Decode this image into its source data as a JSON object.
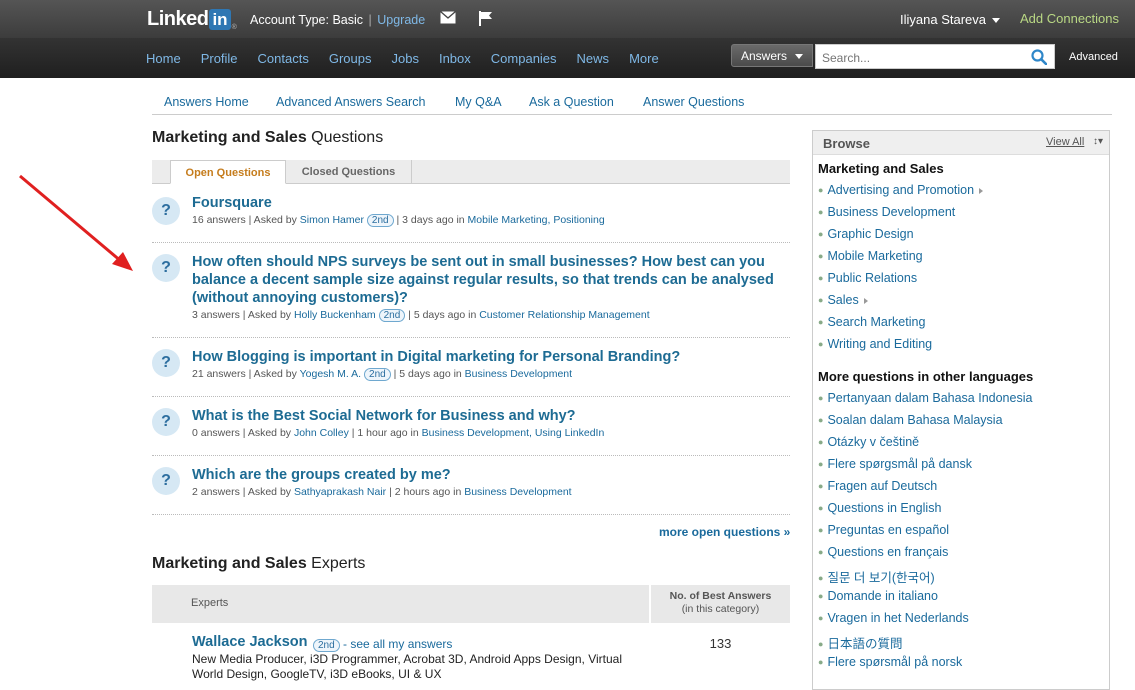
{
  "topbar": {
    "logo_text": "Linked",
    "logo_in": "in",
    "logo_reg": "®",
    "account_type": "Account Type: Basic",
    "separator": "|",
    "upgrade": "Upgrade",
    "user_name": "Iliyana Stareva",
    "add_connections": "Add Connections"
  },
  "nav": {
    "items": [
      "Home",
      "Profile",
      "Contacts",
      "Groups",
      "Jobs",
      "Inbox",
      "Companies",
      "News",
      "More"
    ],
    "search_type": "Answers",
    "search_placeholder": "Search...",
    "advanced": "Advanced"
  },
  "subnav": {
    "items": [
      "Answers Home",
      "Advanced Answers Search",
      "My Q&A",
      "Ask a Question",
      "Answer Questions"
    ]
  },
  "questions_section": {
    "title_bold": "Marketing and Sales",
    "title_rest": " Questions",
    "tabs": [
      "Open Questions",
      "Closed Questions"
    ],
    "icon_char": "?",
    "items": [
      {
        "title": "Foursquare",
        "answers": "16 answers",
        "asked_by": " | Asked by ",
        "author": "Simon Hamer",
        "degree": "2nd",
        "when": " | 3 days ago in ",
        "categories": "Mobile Marketing, Positioning"
      },
      {
        "title": "How often should NPS surveys be sent out in small businesses? How best can you balance a decent sample size against regular results, so that trends can be analysed (without annoying customers)?",
        "answers": "3 answers",
        "asked_by": " | Asked by ",
        "author": "Holly Buckenham",
        "degree": "2nd",
        "when": " | 5 days ago in ",
        "categories": "Customer Relationship Management"
      },
      {
        "title": "How Blogging is important in Digital marketing for Personal Branding?",
        "answers": "21 answers",
        "asked_by": " | Asked by ",
        "author": "Yogesh M. A.",
        "degree": "2nd",
        "when": " | 5 days ago in ",
        "categories": "Business Development"
      },
      {
        "title": "What is the Best Social Network for Business and why?",
        "answers": "0 answers",
        "asked_by": " | Asked by ",
        "author": "John Colley",
        "degree": "",
        "when": " | 1 hour ago in ",
        "categories": "Business Development, Using LinkedIn"
      },
      {
        "title": "Which are the groups created by me?",
        "answers": "2 answers",
        "asked_by": " | Asked by ",
        "author": "Sathyaprakash Nair",
        "degree": "",
        "when": " | 2 hours ago in ",
        "categories": "Business Development"
      }
    ],
    "more_link": "more open questions »"
  },
  "experts_section": {
    "title_bold": "Marketing and Sales",
    "title_rest": " Experts",
    "col_experts": "Experts",
    "col_best_bold": "No. of Best Answers",
    "col_best_sub": "(in this category)",
    "expert": {
      "name": "Wallace Jackson",
      "degree": "2nd",
      "see_all": "- see all my answers",
      "description": "New Media Producer, i3D Programmer, Acrobat 3D, Android Apps Design, Virtual World Design, GoogleTV, i3D eBooks, UI & UX",
      "best_answers": "133"
    }
  },
  "browse": {
    "title": "Browse",
    "view_all": "View All",
    "view_caret": "↕▾",
    "bullet": "●",
    "category_title": "Marketing and Sales",
    "categories": [
      {
        "label": "Advertising and Promotion",
        "expandable": true
      },
      {
        "label": "Business Development",
        "expandable": false
      },
      {
        "label": "Graphic Design",
        "expandable": false
      },
      {
        "label": "Mobile Marketing",
        "expandable": false
      },
      {
        "label": "Public Relations",
        "expandable": false
      },
      {
        "label": "Sales",
        "expandable": true
      },
      {
        "label": "Search Marketing",
        "expandable": false
      },
      {
        "label": "Writing and Editing",
        "expandable": false
      }
    ],
    "languages_title": "More questions in other languages",
    "languages": [
      "Pertanyaan dalam Bahasa Indonesia",
      "Soalan dalam Bahasa Malaysia",
      "Otázky v češtině",
      "Flere spørgsmål på dansk",
      "Fragen auf Deutsch",
      "Questions in English",
      "Preguntas en español",
      "Questions en français",
      "질문 더 보기(한국어)",
      "Domande in italiano",
      "Vragen in het Nederlands",
      "日本語の質問",
      "Flere spørsmål på norsk"
    ]
  },
  "colors": {
    "link": "#1a6a9c",
    "question_title": "#1d6b93",
    "active_tab": "#c57c1c",
    "add_connections": "#b9d884",
    "annotation_arrow": "#e02020"
  }
}
